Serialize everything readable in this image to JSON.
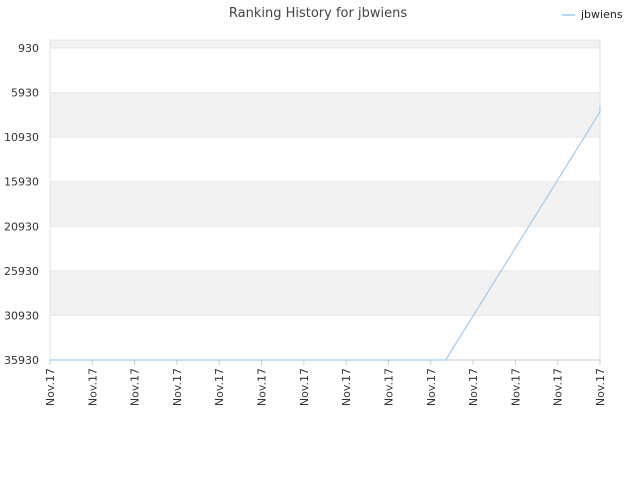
{
  "chart_data": {
    "type": "line",
    "title": "Ranking History for jbwiens",
    "xlabel": "",
    "ylabel": "",
    "y_inverted": true,
    "ylim": [
      930,
      35930
    ],
    "y_ticks": [
      930,
      5930,
      10930,
      15930,
      20930,
      25930,
      30930,
      35930
    ],
    "x_tick_labels": [
      "Nov.17",
      "Nov.17",
      "Nov.17",
      "Nov.17",
      "Nov.17",
      "Nov.17",
      "Nov.17",
      "Nov.17",
      "Nov.17",
      "Nov.17",
      "Nov.17",
      "Nov.17",
      "Nov.17",
      "Nov.17"
    ],
    "x_range": [
      0,
      13
    ],
    "grid": true,
    "legend_position": "top-right",
    "series": [
      {
        "name": "jbwiens",
        "color": "#a0ccf0",
        "points": [
          {
            "x": 0,
            "y": 35930
          },
          {
            "x": 9.35,
            "y": 35930
          },
          {
            "x": 13,
            "y": 8100
          },
          {
            "x": 13,
            "y": 7400
          }
        ]
      }
    ]
  }
}
